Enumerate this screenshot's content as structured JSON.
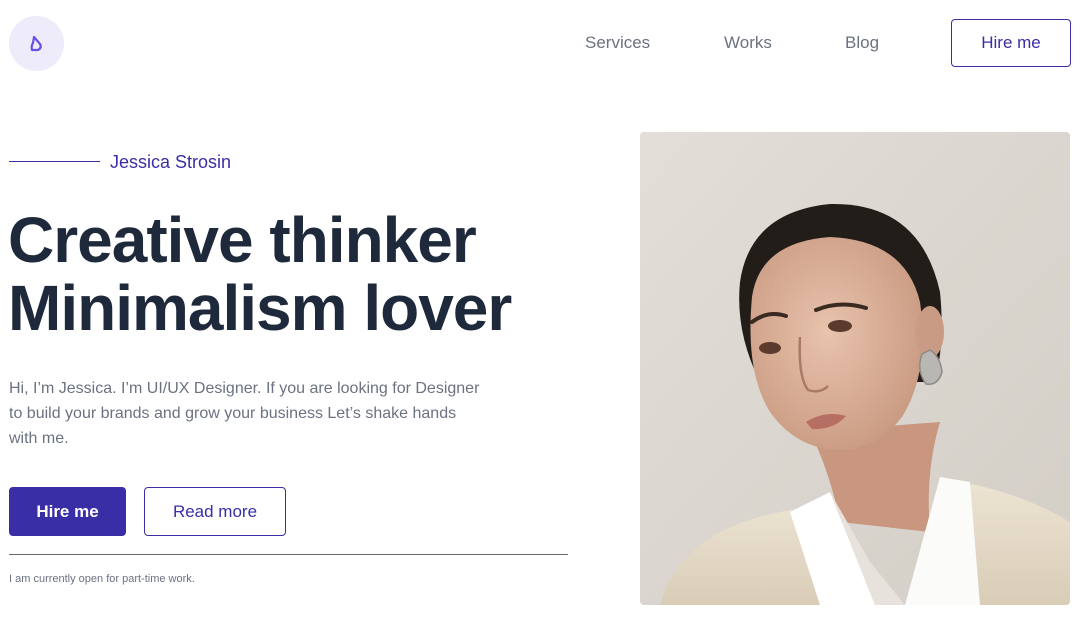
{
  "header": {
    "logo_icon": "logo-mark-icon",
    "nav": [
      {
        "label": "Services"
      },
      {
        "label": "Works"
      },
      {
        "label": "Blog"
      }
    ],
    "cta_label": "Hire me"
  },
  "hero": {
    "name": "Jessica Strosin",
    "headline_line1": "Creative thinker",
    "headline_line2": "Minimalism lover",
    "intro_line1": "Hi, I’m Jessica. I’m UI/UX Designer. If you are looking for Designer",
    "intro_line2": "to build your brands and grow your business Let’s shake hands",
    "intro_line3": "with me.",
    "primary_button": "Hire me",
    "secondary_button": "Read more",
    "availability_note": "I am currently open for part-time work."
  },
  "portrait": {
    "icon": "portrait-photo"
  },
  "colors": {
    "accent": "#3a2ea7",
    "heading": "#1e293b",
    "muted": "#6b7280",
    "logo_bg": "#eeebfb"
  }
}
